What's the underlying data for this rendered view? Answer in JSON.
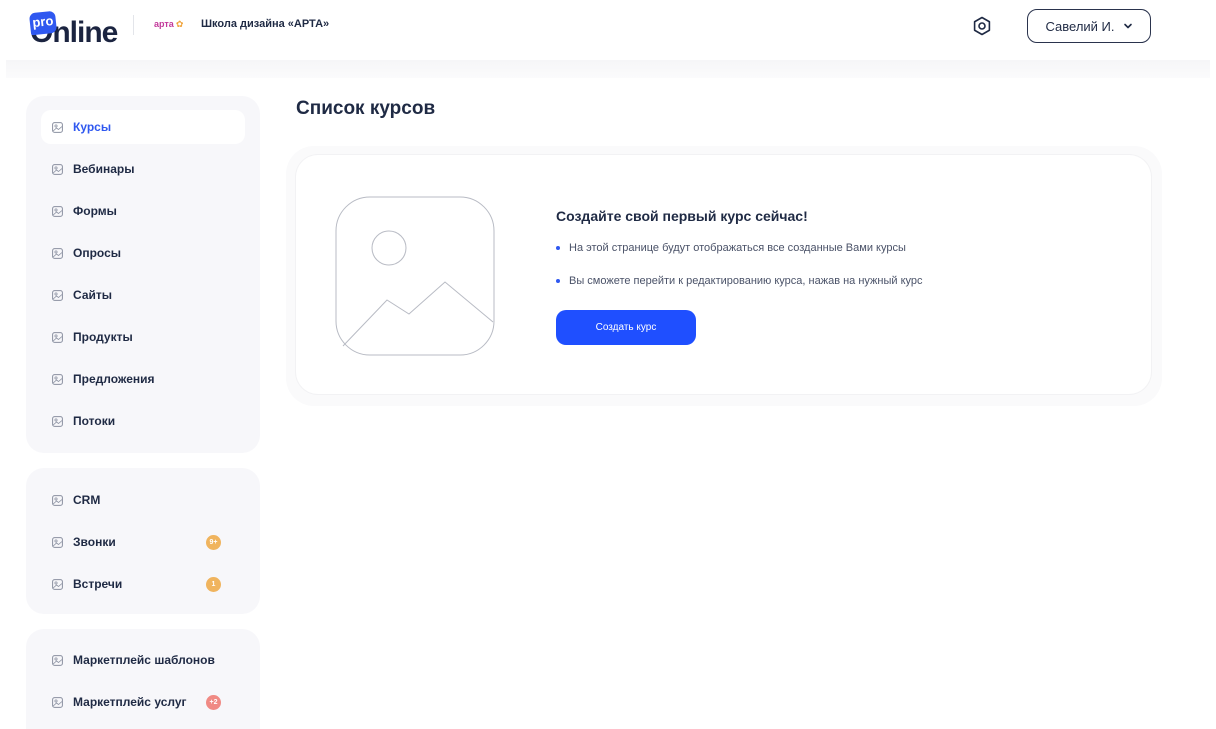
{
  "header": {
    "logo_pro": "pro",
    "logo_online": "Online",
    "school_logo": "арта",
    "school_name": "Школа дизайна «АРТА»",
    "settings_icon": "settings-icon",
    "user_name": "Савелий И."
  },
  "sidebar": {
    "group1": [
      {
        "label": "Курсы",
        "active": true
      },
      {
        "label": "Вебинары"
      },
      {
        "label": "Формы"
      },
      {
        "label": "Опросы"
      },
      {
        "label": "Сайты"
      },
      {
        "label": "Продукты"
      },
      {
        "label": "Предложения"
      },
      {
        "label": "Потоки"
      }
    ],
    "group2": [
      {
        "label": "CRM"
      },
      {
        "label": "Звонки",
        "badge": "9+"
      },
      {
        "label": "Встречи",
        "badge": "1"
      }
    ],
    "group3": [
      {
        "label": "Маркетплейс шаблонов"
      },
      {
        "label": "Маркетплейс услуг",
        "badge": "+2"
      }
    ]
  },
  "main": {
    "title": "Список курсов",
    "empty_title": "Создайте свой первый курс сейчас!",
    "bullets": [
      "На этой странице будут отображаться все созданные Вами курсы",
      "Вы сможете перейти к редактированию курса, нажав на нужный курс"
    ],
    "create_button": "Создать курс"
  },
  "colors": {
    "accent": "#1f4fff",
    "badge_orange": "#f0b45e",
    "badge_red": "#f08a84",
    "text": "#1f2a44"
  }
}
